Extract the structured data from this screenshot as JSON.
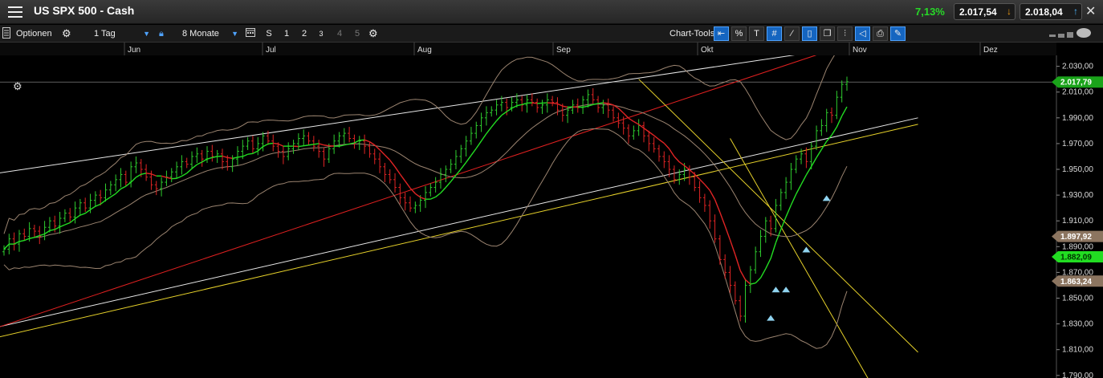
{
  "header": {
    "title": "US SPX 500 - Cash",
    "change_pct": "7,13%",
    "bid": "2.017,54",
    "ask": "2.018,04",
    "bid_arrow": "↓",
    "ask_arrow": "↑",
    "close": "✕"
  },
  "toolbar": {
    "options_label": "Optionen",
    "interval": "1 Tag",
    "range": "8 Monate",
    "size_buttons": [
      "S",
      "1",
      "2",
      "3",
      "4",
      "5"
    ],
    "chart_tools_label": "Chart-Tools",
    "percent_label": "%",
    "text_label": "T"
  },
  "colors": {
    "up_candle": "#2ecc2e",
    "down_candle": "#e02424",
    "ma_fast": "#22dd22",
    "ma_fast_down": "#e02424",
    "bollinger": "#9b8470",
    "red_trend": "#e02020",
    "yellow_trend": "#e6d12a",
    "white_trend": "#e8e8e8",
    "marker": "#8fd3ef"
  },
  "chart_data": {
    "type": "candlestick",
    "x_axis_months": [
      "Jun",
      "Jul",
      "Aug",
      "Sep",
      "Okt",
      "Nov",
      "Dez"
    ],
    "y_ticks": [
      "2.030,00",
      "2.010,00",
      "1.990,00",
      "1.970,00",
      "1.950,00",
      "1.930,00",
      "1.910,00",
      "1.890,00",
      "1.870,00",
      "1.850,00",
      "1.830,00",
      "1.810,00",
      "1.790,00"
    ],
    "ylim": [
      1788,
      2036
    ],
    "last_price": "2.017,79",
    "level_labels": [
      {
        "text": "1.897,92",
        "kind": "upper"
      },
      {
        "text": "1.882,09",
        "kind": "current-ma"
      },
      {
        "text": "1.863,24",
        "kind": "lower"
      }
    ],
    "price_path": [
      1888,
      1896,
      1892,
      1900,
      1898,
      1904,
      1902,
      1898,
      1905,
      1910,
      1906,
      1912,
      1916,
      1913,
      1920,
      1924,
      1920,
      1926,
      1930,
      1928,
      1934,
      1938,
      1942,
      1946,
      1940,
      1952,
      1955,
      1950,
      1944,
      1938,
      1935,
      1940,
      1944,
      1948,
      1952,
      1956,
      1954,
      1960,
      1962,
      1958,
      1964,
      1960,
      1962,
      1956,
      1952,
      1958,
      1964,
      1968,
      1972,
      1966,
      1970,
      1976,
      1972,
      1968,
      1964,
      1960,
      1966,
      1970,
      1974,
      1976,
      1972,
      1968,
      1964,
      1958,
      1966,
      1972,
      1976,
      1978,
      1974,
      1970,
      1972,
      1968,
      1962,
      1958,
      1952,
      1946,
      1942,
      1936,
      1928,
      1924,
      1920,
      1922,
      1926,
      1932,
      1936,
      1940,
      1946,
      1950,
      1954,
      1960,
      1966,
      1972,
      1978,
      1984,
      1990,
      1994,
      1996,
      2000,
      2002,
      1998,
      2002,
      2004,
      2000,
      2004,
      2002,
      1998,
      2000,
      2004,
      2002,
      1996,
      1992,
      1996,
      2000,
      1998,
      2004,
      2008,
      2004,
      1998,
      2000,
      1996,
      1990,
      1986,
      1982,
      1976,
      1980,
      1984,
      1976,
      1970,
      1966,
      1960,
      1956,
      1950,
      1942,
      1946,
      1950,
      1944,
      1936,
      1928,
      1922,
      1910,
      1896,
      1880,
      1870,
      1860,
      1848,
      1836,
      1860,
      1872,
      1886,
      1898,
      1910,
      1904,
      1922,
      1932,
      1940,
      1950,
      1958,
      1962,
      1956,
      1968,
      1980,
      1984,
      1994,
      1992,
      2006,
      2016,
      2018
    ]
  }
}
